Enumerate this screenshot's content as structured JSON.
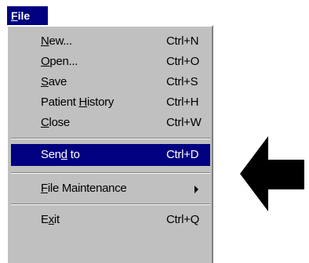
{
  "menubar": {
    "file_prefix": "F",
    "file_rest": "ile"
  },
  "menu": {
    "items": [
      {
        "pre": "",
        "mn": "N",
        "post": "ew...",
        "shortcut": "Ctrl+N"
      },
      {
        "pre": "",
        "mn": "O",
        "post": "pen...",
        "shortcut": "Ctrl+O"
      },
      {
        "pre": "",
        "mn": "S",
        "post": "ave",
        "shortcut": "Ctrl+S"
      },
      {
        "pre": "Patient ",
        "mn": "H",
        "post": "istory",
        "shortcut": "Ctrl+H"
      },
      {
        "pre": "",
        "mn": "C",
        "post": "lose",
        "shortcut": "Ctrl+W"
      },
      {
        "pre": "Sen",
        "mn": "d",
        "post": " to",
        "shortcut": "Ctrl+D"
      },
      {
        "pre": "",
        "mn": "F",
        "post": "ile Maintenance",
        "shortcut": ""
      },
      {
        "pre": "E",
        "mn": "x",
        "post": "it",
        "shortcut": "Ctrl+Q"
      }
    ]
  },
  "colors": {
    "highlight": "#000080",
    "menu_bg": "#c0c0c0",
    "arrow": "#000000"
  },
  "icons": {
    "submenu": "triangle-right-icon",
    "pointer": "left-arrow-icon"
  }
}
